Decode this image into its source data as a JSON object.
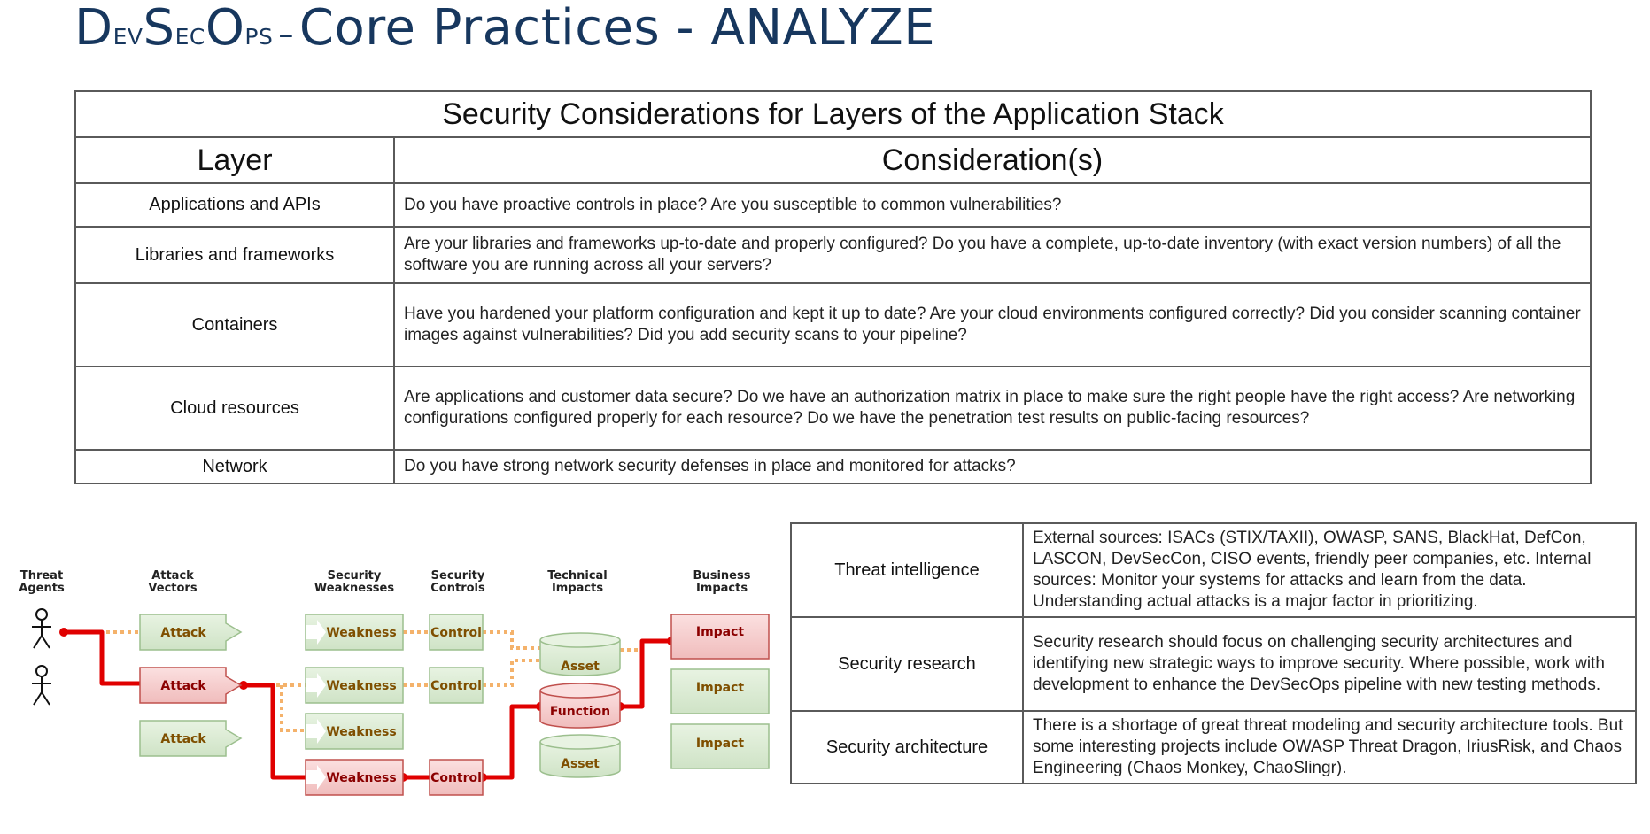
{
  "title": {
    "brand_d": "D",
    "brand_ev": "ev",
    "brand_s": "S",
    "brand_ec": "ec",
    "brand_o": "O",
    "brand_ps": "ps",
    "dash": "–",
    "rest": "Core Practices - ANALYZE"
  },
  "layers_table": {
    "caption": "Security Considerations for Layers of the Application Stack",
    "col_layer": "Layer",
    "col_considerations": "Consideration(s)",
    "rows": [
      {
        "layer": "Applications and APIs",
        "consideration": "Do you have proactive controls in place? Are you susceptible to common vulnerabilities?"
      },
      {
        "layer": "Libraries and frameworks",
        "consideration": "Are your libraries and frameworks up-to-date and properly configured? Do you have a complete, up-to-date inventory (with exact version numbers) of all the software you are running across all your servers?"
      },
      {
        "layer": "Containers",
        "consideration": "Have you hardened your platform configuration and kept it up to date? Are your cloud environments configured correctly? Did you consider scanning container images against vulnerabilities? Did you add security scans to your pipeline?"
      },
      {
        "layer": "Cloud resources",
        "consideration": "Are applications and customer data secure? Do we have an authorization matrix in place to make sure the right people have the right access? Are networking configurations configured properly for each resource? Do we have the penetration test results on public-facing resources?"
      },
      {
        "layer": "Network",
        "consideration": "Do you have strong network security defenses in place and monitored for attacks?"
      }
    ]
  },
  "practices_table": {
    "rows": [
      {
        "name": "Threat intelligence",
        "description": "External sources: ISACs (STIX/TAXII), OWASP, SANS, BlackHat, DefCon, LASCON, DevSecCon, CISO events, friendly peer companies, etc. Internal sources: Monitor your systems for attacks and learn from the data. Understanding actual attacks is a major factor in prioritizing."
      },
      {
        "name": "Security research",
        "description": "Security research should focus on challenging security architectures and identifying new strategic ways to improve security. Where possible, work with development to enhance the DevSecOps pipeline with new testing methods."
      },
      {
        "name": "Security architecture",
        "description": "There is a shortage of great threat modeling and security architecture tools. But some interesting projects include OWASP Threat Dragon, IriusRisk, and Chaos Engineering (Chaos Monkey, ChaoSlingr)."
      }
    ]
  },
  "diagram": {
    "headers": {
      "threat_agents": [
        "Threat",
        "Agents"
      ],
      "attack_vectors": [
        "Attack",
        "Vectors"
      ],
      "security_weaknesses": [
        "Security",
        "Weaknesses"
      ],
      "security_controls": [
        "Security",
        "Controls"
      ],
      "technical_impacts": [
        "Technical",
        "Impacts"
      ],
      "business_impacts": [
        "Business",
        "Impacts"
      ]
    },
    "attack_label": "Attack",
    "weakness_label": "Weakness",
    "control_label": "Control",
    "asset_label": "Asset",
    "function_label": "Function",
    "impact_label": "Impact",
    "colors": {
      "green_fill": "#d9ead3",
      "green_stroke": "#9cbf8e",
      "red_fill": "#f4cccc",
      "red_stroke": "#c0504d",
      "path_red": "#e00000",
      "path_orange": "#f4b26b",
      "text_brown": "#7f4f00",
      "text_darkred": "#8b0000"
    }
  }
}
